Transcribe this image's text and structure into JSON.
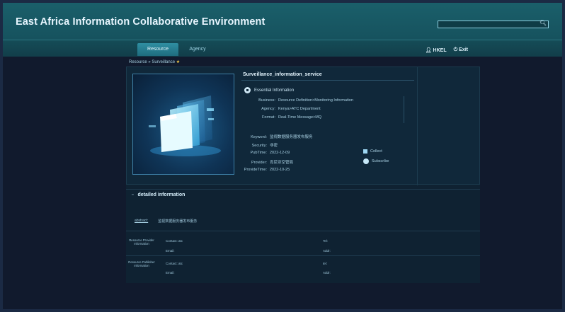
{
  "header": {
    "app_title": "East Africa Information Collaborative Environment",
    "search_placeholder": ""
  },
  "nav": {
    "tabs": [
      {
        "label": "Resource",
        "active": true
      },
      {
        "label": "Agency",
        "active": false
      }
    ],
    "user": "HKEL",
    "exit": "Exit"
  },
  "breadcrumb": {
    "path": "Resource » Surveillance"
  },
  "service": {
    "title": "Surveillance_information_service",
    "essential_label": "Essential Information",
    "info": [
      {
        "key": "Business:",
        "value": "Resource Definition>Monitoring Information"
      },
      {
        "key": "Agency:",
        "value": "Kenya>ATC Department"
      },
      {
        "key": "Format:",
        "value": "Real-Time Message>MQ"
      }
    ],
    "meta": [
      {
        "key": "Keyword:",
        "value": "监视数据服务器发布服务"
      },
      {
        "key": "Security:",
        "value": "非密"
      },
      {
        "key": "PubTime:",
        "value": "2022-12-09"
      },
      {
        "key": "Provider:",
        "value": "肯尼亚空管局"
      },
      {
        "key": "ProvideTime:",
        "value": "2022-10-25"
      }
    ],
    "actions": {
      "collect": "Collect",
      "subscribe": "Subscribe"
    }
  },
  "detail": {
    "header": "detailed information",
    "abstract_label": "abstract:",
    "abstract_value": "监视数据服务器发布服务",
    "provider_label": "Resource Provider Information",
    "provider_contact": "Contact:  atc",
    "provider_tel": "Tel:",
    "provider_email": "Email:",
    "provider_addr": "Addr:",
    "publisher_label": "Resource Publisher Information",
    "publisher_contact": "Contact:  atc",
    "publisher_tel": "tel:",
    "publisher_email": "Email:",
    "publisher_addr": "Addr:"
  },
  "colors": {
    "accent": "#2f8fa2",
    "header_bg": "#1a5f6a",
    "panel_bg": "#10283a"
  }
}
